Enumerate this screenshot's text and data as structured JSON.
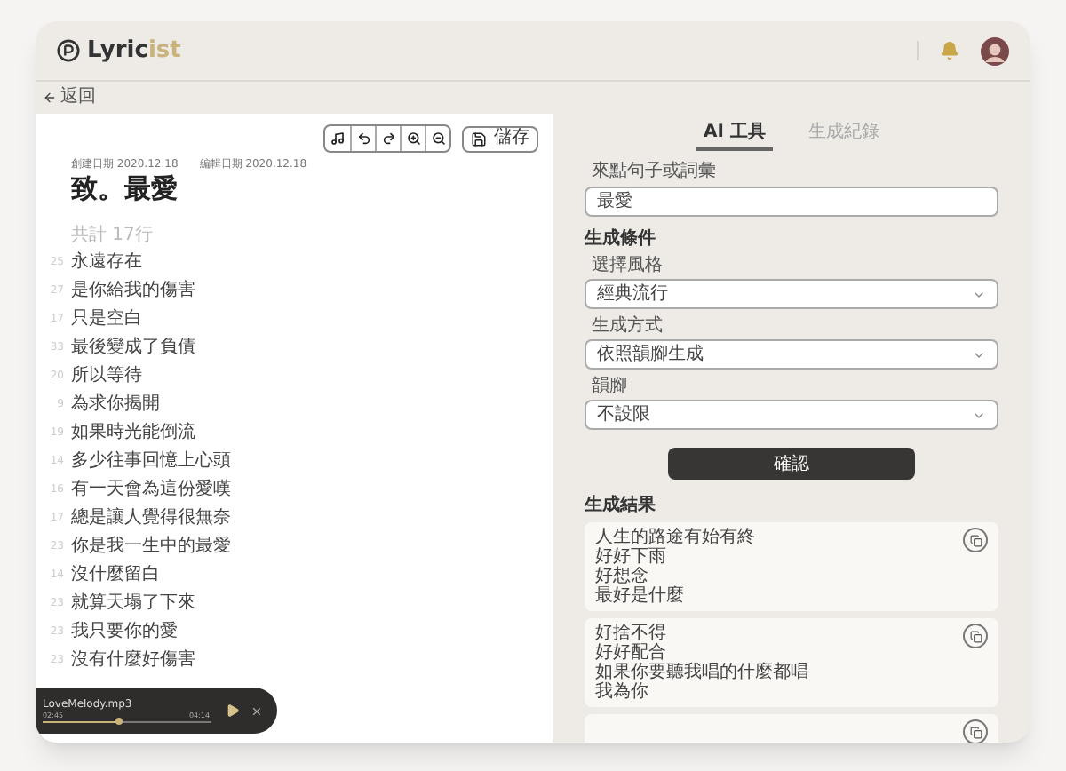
{
  "header": {
    "logo": {
      "text": "Lyric",
      "accent": "ist"
    }
  },
  "back": "返回",
  "editor": {
    "toolbar": [
      {
        "kind": "music"
      },
      {
        "kind": "undo"
      },
      {
        "kind": "redo"
      },
      {
        "kind": "zoom-in"
      },
      {
        "kind": "zoom-out"
      }
    ],
    "save": "儲存",
    "created": "創建日期 2020.12.18",
    "edited": "編輯日期 2020.12.18",
    "title": "致。最愛",
    "count": "共計 17行",
    "lines": [
      {
        "n": "25",
        "text": "永遠存在"
      },
      {
        "n": "27",
        "text": "是你給我的傷害"
      },
      {
        "n": "17",
        "text": "只是空白"
      },
      {
        "n": "33",
        "text": "最後變成了負債"
      },
      {
        "n": "20",
        "text": "所以等待"
      },
      {
        "n": "9",
        "text": "為求你揭開"
      },
      {
        "n": "19",
        "text": "如果時光能倒流"
      },
      {
        "n": "14",
        "text": "多少往事回憶上心頭"
      },
      {
        "n": "16",
        "text": "有一天會為這份愛嘆"
      },
      {
        "n": "17",
        "text": "總是讓人覺得很無奈"
      },
      {
        "n": "23",
        "text": "你是我一生中的最愛"
      },
      {
        "n": "14",
        "text": "沒什麼留白"
      },
      {
        "n": "23",
        "text": "就算天塌了下來"
      },
      {
        "n": "23",
        "text": "我只要你的愛"
      },
      {
        "n": "23",
        "text": "沒有什麼好傷害"
      }
    ]
  },
  "player": {
    "file": "LoveMelody.mp3",
    "elapsed": "02:45",
    "total": "04:14",
    "level": 0.45
  },
  "tabs": [
    {
      "label": "AI 工具",
      "selected": true
    },
    {
      "label": "生成紀錄",
      "selected": false
    }
  ],
  "prompt": {
    "label": "來點句子或詞彙",
    "value": "最愛"
  },
  "conditions": {
    "heading": "生成條件",
    "selects": [
      {
        "label": "選擇風格",
        "value": "經典流行"
      },
      {
        "label": "生成方式",
        "value": "依照韻腳生成"
      },
      {
        "label": "韻腳",
        "value": "不設限"
      }
    ]
  },
  "confirm": "確認",
  "results": {
    "heading": "生成結果",
    "cards": [
      {
        "kind": "full",
        "lines": [
          "人生的路途有始有終",
          "好好下雨",
          "好想念",
          "最好是什麼"
        ]
      },
      {
        "kind": "full",
        "lines": [
          "好捨不得",
          "好好配合",
          "如果你要聽我唱的什麼都唱",
          "我為你"
        ]
      },
      {
        "kind": "partial"
      }
    ]
  }
}
